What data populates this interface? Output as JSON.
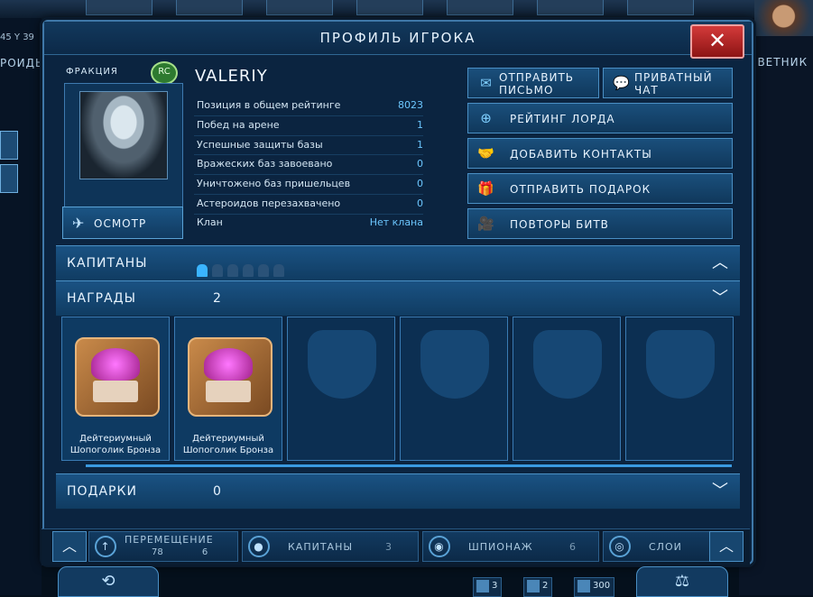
{
  "background": {
    "coord": "45 Y 39",
    "left_label": "РОИДЬ",
    "right_label": "ОВЕТНИК"
  },
  "dialog": {
    "title": "ПРОФИЛЬ ИГРОКА",
    "close": "✕"
  },
  "profile": {
    "faction_label": "ФРАКЦИЯ",
    "faction_badge": "RC",
    "name": "VALERIY",
    "inspect_label": "ОСМОТР",
    "stats": [
      {
        "label": "Позиция в общем рейтинге",
        "value": "8023"
      },
      {
        "label": "Побед на арене",
        "value": "1"
      },
      {
        "label": "Успешные защиты базы",
        "value": "1"
      },
      {
        "label": "Вражеских баз завоевано",
        "value": "0"
      },
      {
        "label": "Уничтожено баз пришельцев",
        "value": "0"
      },
      {
        "label": "Астероидов перезахвачено",
        "value": "0"
      }
    ],
    "clan_label": "Клан",
    "clan_value": "Нет клана"
  },
  "actions": {
    "send_mail": "ОТПРАВИТЬ\nПИСЬМО",
    "private_chat": "ПРИВАТНЫЙ\nЧАТ",
    "lord_rating": "РЕЙТИНГ ЛОРДА",
    "add_contacts": "ДОБАВИТЬ КОНТАКТЫ",
    "send_gift": "ОТПРАВИТЬ ПОДАРОК",
    "battle_replays": "ПОВТОРЫ БИТВ"
  },
  "sections": {
    "captains": {
      "title": "КАПИТАНЫ",
      "filled": 1,
      "total": 6
    },
    "awards": {
      "title": "НАГРАДЫ",
      "count": "2"
    },
    "gifts": {
      "title": "ПОДАРКИ",
      "count": "0"
    }
  },
  "awards": [
    {
      "line1": "Дейтериумный",
      "line2": "Шопоголик Бронза"
    },
    {
      "line1": "Дейтериумный",
      "line2": "Шопоголик Бронза"
    }
  ],
  "bottom_bar": {
    "move_label": "ПЕРЕМЕЩЕНИЕ",
    "move_a": "78",
    "move_b": "6",
    "captains_label": "КАПИТАНЫ",
    "captains_count": "3",
    "spy_label": "ШПИОНАЖ",
    "spy_count": "6",
    "layers_label": "СЛОИ"
  },
  "resources": [
    {
      "value": "3"
    },
    {
      "value": "2"
    },
    {
      "value": "300"
    }
  ]
}
